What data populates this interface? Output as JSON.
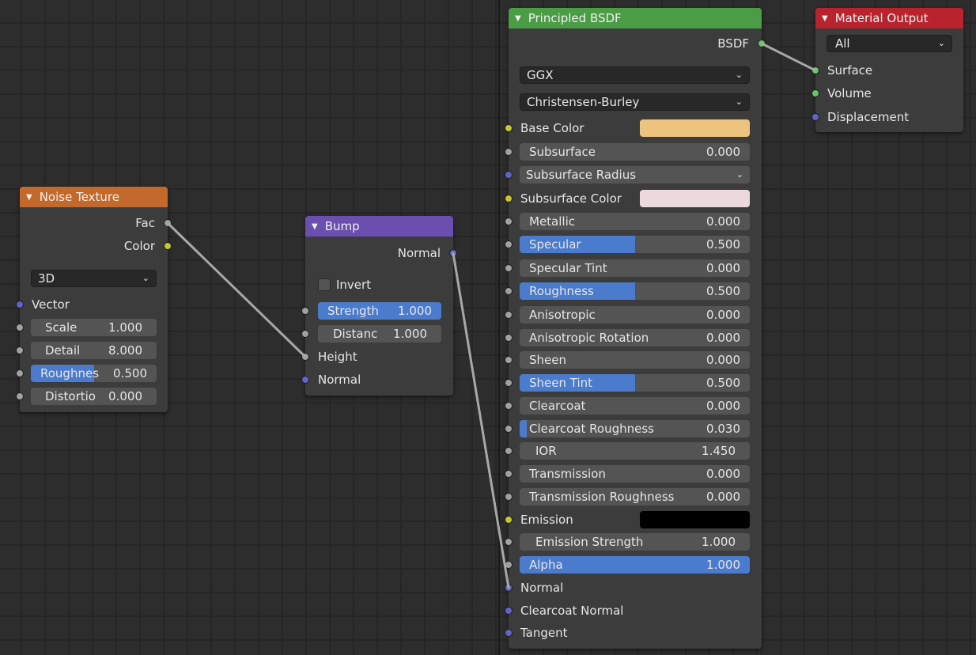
{
  "colors": {
    "texture_header": "#c3692b",
    "vector_header": "#6a4fae",
    "shader_header": "#4a9c45",
    "output_header": "#b8232d",
    "socket_float": "#a1a1a1",
    "socket_color": "#c7c729",
    "socket_vector": "#6363c7",
    "socket_shader": "#63c763",
    "slider_fill": "#4b7bcc"
  },
  "noise": {
    "title": "Noise Texture",
    "out_fac": "Fac",
    "out_color": "Color",
    "dimensions": "3D",
    "in_vector": "Vector",
    "scale_label": "Scale",
    "scale_value": "1.000",
    "detail_label": "Detail",
    "detail_value": "8.000",
    "roughness_label": "Roughnes",
    "roughness_value": "0.500",
    "roughness_fill": 0.5,
    "distortion_label": "Distortio",
    "distortion_value": "0.000"
  },
  "bump": {
    "title": "Bump",
    "out_normal": "Normal",
    "invert_label": "Invert",
    "strength_label": "Strength",
    "strength_value": "1.000",
    "strength_fill": 1.0,
    "distance_label": "Distanc",
    "distance_value": "1.000",
    "in_height": "Height",
    "in_normal": "Normal"
  },
  "bsdf": {
    "title": "Principled BSDF",
    "out_bsdf": "BSDF",
    "distribution": "GGX",
    "subsurface_method": "Christensen-Burley",
    "base_color_label": "Base Color",
    "base_color": "#ecc37f",
    "subsurface_label": "Subsurface",
    "subsurface_value": "0.000",
    "subsurface_radius_label": "Subsurface Radius",
    "subsurface_color_label": "Subsurface Color",
    "subsurface_color": "#ecd9de",
    "metallic_label": "Metallic",
    "metallic_value": "0.000",
    "specular_label": "Specular",
    "specular_value": "0.500",
    "specular_fill": 0.5,
    "specular_tint_label": "Specular Tint",
    "specular_tint_value": "0.000",
    "roughness_label": "Roughness",
    "roughness_value": "0.500",
    "roughness_fill": 0.5,
    "anisotropic_label": "Anisotropic",
    "anisotropic_value": "0.000",
    "anisotropic_rotation_label": "Anisotropic Rotation",
    "anisotropic_rotation_value": "0.000",
    "sheen_label": "Sheen",
    "sheen_value": "0.000",
    "sheen_tint_label": "Sheen Tint",
    "sheen_tint_value": "0.500",
    "sheen_tint_fill": 0.5,
    "clearcoat_label": "Clearcoat",
    "clearcoat_value": "0.000",
    "clearcoat_roughness_label": "Clearcoat Roughness",
    "clearcoat_roughness_value": "0.030",
    "clearcoat_roughness_fill": 0.03,
    "ior_label": "IOR",
    "ior_value": "1.450",
    "transmission_label": "Transmission",
    "transmission_value": "0.000",
    "transmission_roughness_label": "Transmission Roughness",
    "transmission_roughness_value": "0.000",
    "emission_label": "Emission",
    "emission_color": "#000000",
    "emission_strength_label": "Emission Strength",
    "emission_strength_value": "1.000",
    "alpha_label": "Alpha",
    "alpha_value": "1.000",
    "alpha_fill": 1.0,
    "in_normal": "Normal",
    "in_clearcoat_normal": "Clearcoat Normal",
    "in_tangent": "Tangent"
  },
  "output": {
    "title": "Material Output",
    "target": "All",
    "in_surface": "Surface",
    "in_volume": "Volume",
    "in_displacement": "Displacement"
  }
}
